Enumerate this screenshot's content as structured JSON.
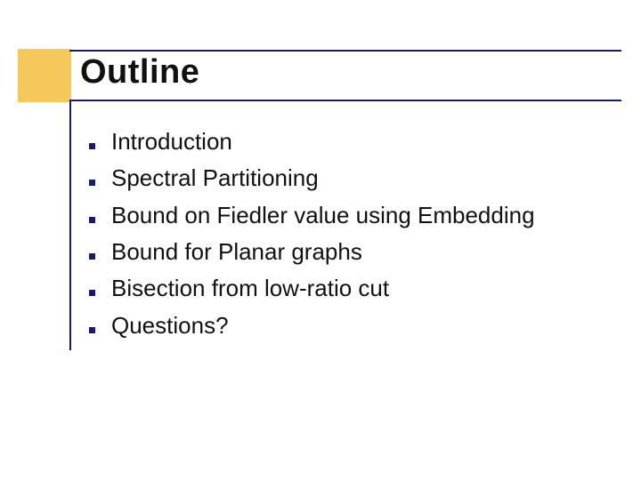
{
  "title": "Outline",
  "items": [
    "Introduction",
    "Spectral Partitioning",
    "Bound on Fiedler value using Embedding",
    "Bound for Planar graphs",
    "Bisection from low-ratio cut",
    "Questions?"
  ]
}
